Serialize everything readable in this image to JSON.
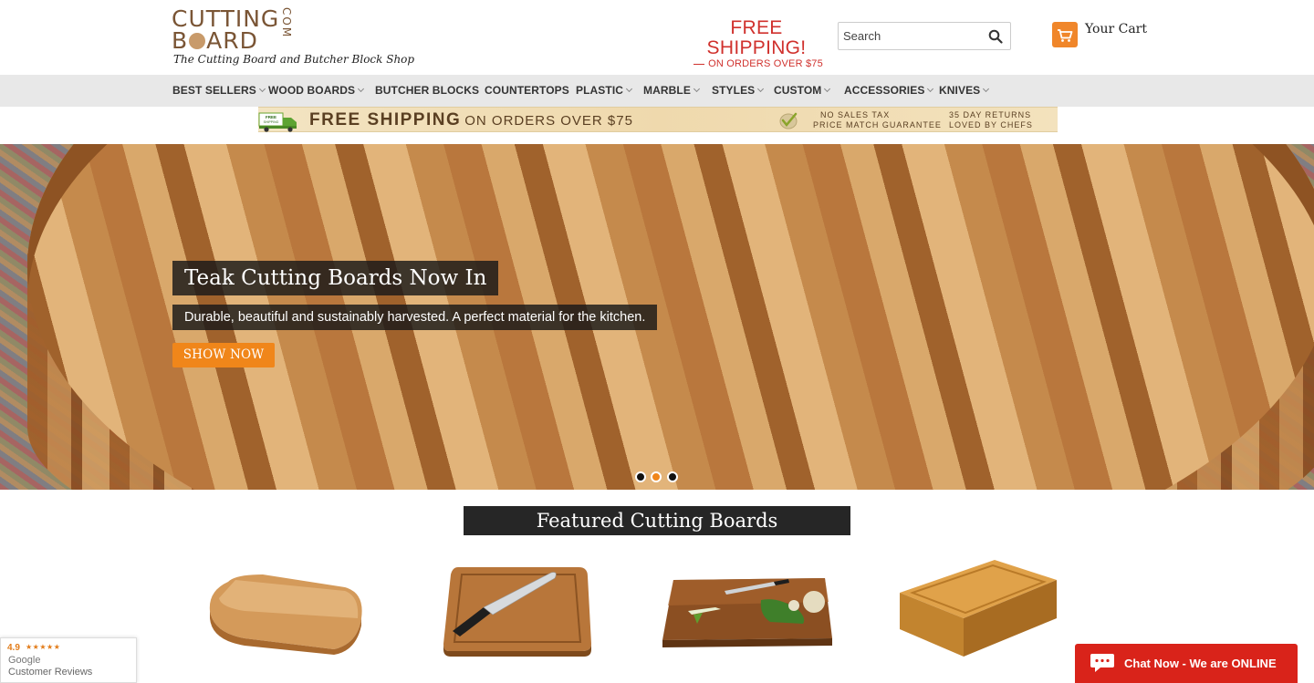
{
  "header": {
    "logo": {
      "line1": "CUTTING",
      "line2_a": "B",
      "line2_b": "ARD",
      "suffix": "COM"
    },
    "tagline": "The Cutting Board and Butcher Block Shop",
    "free_shipping": {
      "headline": "FREE SHIPPING!",
      "subline": "ON ORDERS OVER $75"
    },
    "search": {
      "placeholder": "Search"
    },
    "cart": {
      "label": "Your Cart"
    }
  },
  "nav": {
    "items": [
      {
        "label": "BEST SELLERS",
        "dropdown": true
      },
      {
        "label": "WOOD BOARDS",
        "dropdown": true
      },
      {
        "label": "BUTCHER BLOCKS",
        "dropdown": false
      },
      {
        "label": "COUNTERTOPS",
        "dropdown": false
      },
      {
        "label": "PLASTIC",
        "dropdown": true
      },
      {
        "label": "MARBLE",
        "dropdown": true
      },
      {
        "label": "STYLES",
        "dropdown": true
      },
      {
        "label": "CUSTOM",
        "dropdown": true
      },
      {
        "label": "ACCESSORIES",
        "dropdown": true
      },
      {
        "label": "KNIVES",
        "dropdown": true
      }
    ]
  },
  "promo": {
    "truck_label": "FREE SHIPPING",
    "main": "FREE SHIPPING",
    "main_sub": "ON ORDERS OVER $75",
    "col1_line1": "NO SALES TAX",
    "col1_line2": "PRICE MATCH GUARANTEE",
    "col2_line1": "35 DAY RETURNS",
    "col2_line2": "LOVED BY CHEFS"
  },
  "hero": {
    "title": "Teak Cutting Boards Now In",
    "subtitle": "Durable, beautiful and sustainably harvested. A perfect material for the kitchen.",
    "button": "SHOW NOW",
    "slides": 3,
    "active_slide": 2
  },
  "featured": {
    "title": "Featured Cutting Boards"
  },
  "reviews": {
    "rating": "4.9",
    "stars": "★★★★★",
    "line1": "Google",
    "line2": "Customer Reviews"
  },
  "chat": {
    "label": "Chat Now - We are ONLINE"
  },
  "colors": {
    "accent_orange": "#f0861a",
    "shipping_red": "#d0312d",
    "chat_red": "#d9231a",
    "logo_brown": "#7a5535"
  },
  "icons": {
    "search": "search-icon",
    "cart": "cart-icon",
    "truck": "truck-icon",
    "check": "check-icon",
    "chat": "chat-icon"
  }
}
